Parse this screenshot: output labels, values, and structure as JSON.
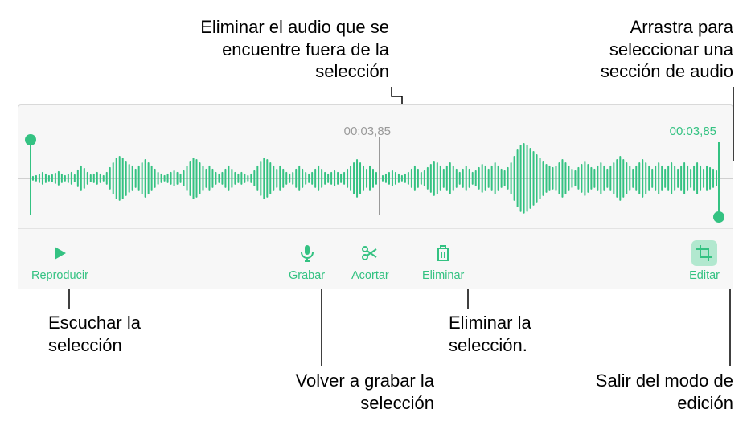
{
  "callouts": {
    "trim_desc": "Eliminar el audio que se encuentre fuera de la selección",
    "drag_desc": "Arrastra para seleccionar una sección de audio",
    "play_desc": "Escuchar la selección",
    "record_desc": "Volver a grabar la selección",
    "delete_desc": "Eliminar la selección.",
    "edit_desc": "Salir del modo de edición"
  },
  "timestamps": {
    "playhead": "00:03,85",
    "end": "00:03,85"
  },
  "toolbar": {
    "play": "Reproducir",
    "record": "Grabar",
    "trim": "Acortar",
    "delete": "Eliminar",
    "edit": "Editar"
  },
  "colors": {
    "accent": "#34c282"
  }
}
